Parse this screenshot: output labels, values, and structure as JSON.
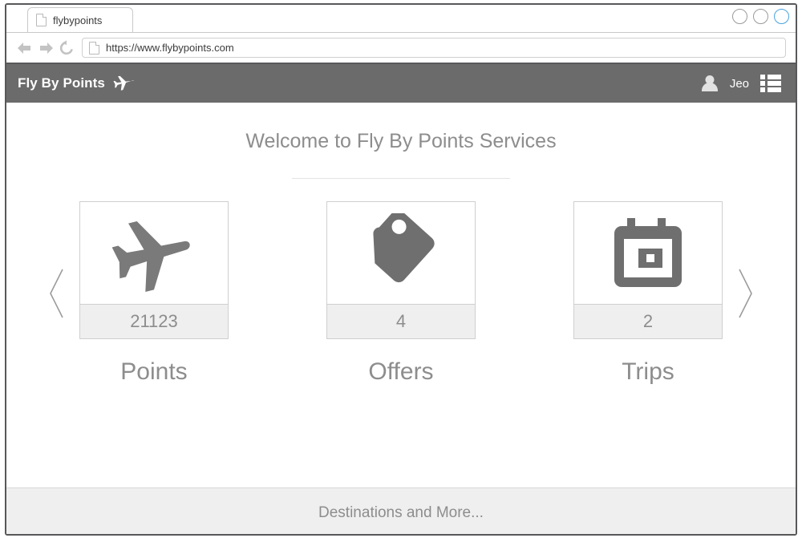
{
  "browser": {
    "tab": {
      "title": "flybypoints",
      "icon": "document-icon"
    },
    "window_controls": [
      {
        "name": "minimize",
        "active": false
      },
      {
        "name": "maximize",
        "active": false
      },
      {
        "name": "close",
        "active": true
      }
    ],
    "nav": {
      "back_icon": "back-arrow-icon",
      "forward_icon": "forward-arrow-icon",
      "reload_icon": "reload-icon"
    },
    "url": "https://www.flybypoints.com",
    "url_icon": "document-icon"
  },
  "header": {
    "brand": "Fly By Points",
    "brand_icon": "airplane-icon",
    "avatar_icon": "user-avatar-icon",
    "username": "Jeo",
    "menu_icon": "list-menu-icon",
    "background": "#6b6b6b"
  },
  "main": {
    "welcome_title": "Welcome to Fly By Points Services",
    "prev_icon": "chevron-left-icon",
    "next_icon": "chevron-right-icon",
    "cards": [
      {
        "label": "Points",
        "value": "21123",
        "icon": "airplane-icon"
      },
      {
        "label": "Offers",
        "value": "4",
        "icon": "price-tag-icon"
      },
      {
        "label": "Trips",
        "value": "2",
        "icon": "calendar-icon"
      }
    ]
  },
  "footer": {
    "text": "Destinations and More..."
  },
  "colors": {
    "header_bg": "#6b6b6b",
    "icon_gray": "#6f6f6f",
    "text_gray": "#8d8d8d",
    "card_footer_bg": "#efefef",
    "border": "#cfcfcf",
    "active_control": "#4aa3df"
  }
}
